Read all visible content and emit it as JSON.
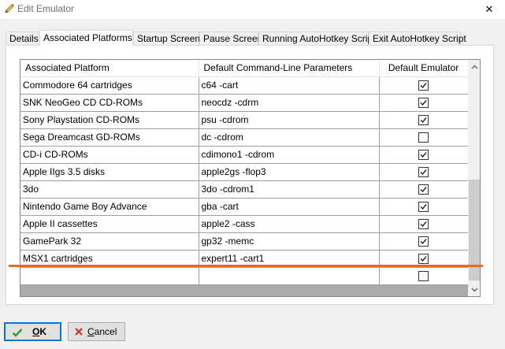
{
  "window": {
    "title": "Edit Emulator",
    "close_glyph": "✕"
  },
  "tabs": [
    {
      "label": "Details"
    },
    {
      "label": "Associated Platforms"
    },
    {
      "label": "Startup Screen"
    },
    {
      "label": "Pause Screen"
    },
    {
      "label": "Running AutoHotkey Script"
    },
    {
      "label": "Exit AutoHotkey Script"
    }
  ],
  "grid": {
    "headers": [
      "Associated Platform",
      "Default Command-Line Parameters",
      "Default Emulator"
    ],
    "rows": [
      {
        "platform": "Commodore 64 cartridges",
        "params": "c64 -cart",
        "default": true
      },
      {
        "platform": "SNK NeoGeo CD CD-ROMs",
        "params": "neocdz -cdrm",
        "default": true
      },
      {
        "platform": "Sony Playstation CD-ROMs",
        "params": "psu -cdrom",
        "default": true
      },
      {
        "platform": "Sega Dreamcast GD-ROMs",
        "params": "dc -cdrom",
        "default": false
      },
      {
        "platform": "CD-i CD-ROMs",
        "params": "cdimono1 -cdrom",
        "default": true
      },
      {
        "platform": "Apple IIgs 3.5 disks",
        "params": "apple2gs -flop3",
        "default": true
      },
      {
        "platform": "3do",
        "params": "3do -cdrom1",
        "default": true
      },
      {
        "platform": "Nintendo Game Boy Advance",
        "params": "gba -cart",
        "default": true
      },
      {
        "platform": "Apple II cassettes",
        "params": "apple2 -cass",
        "default": true
      },
      {
        "platform": "GamePark 32",
        "params": "gp32 -memc",
        "default": true
      },
      {
        "platform": "MSX1 cartridges",
        "params": "expert11 -cart1",
        "default": true
      },
      {
        "platform": "",
        "params": "",
        "default": false
      }
    ]
  },
  "buttons": {
    "ok_label_underlined": "O",
    "ok_label_rest": "K",
    "cancel_label_underlined": "C",
    "cancel_label_rest": "ancel"
  },
  "colors": {
    "accent": "#0078d7",
    "marker": "#e8691f",
    "ok_check": "#2e9c2e",
    "cancel_x": "#d03030"
  },
  "icons": {
    "title": "pencil-icon",
    "ok": "checkmark-icon",
    "cancel": "x-icon"
  }
}
